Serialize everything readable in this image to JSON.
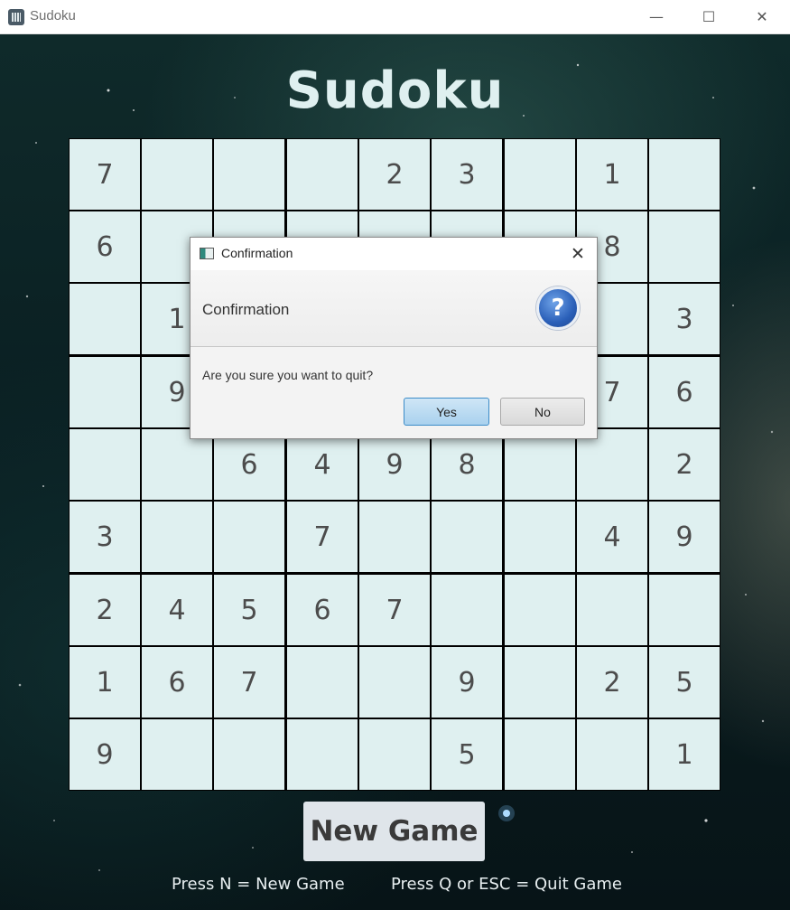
{
  "window": {
    "title": "Sudoku",
    "minimize_glyph": "—",
    "maximize_glyph": "☐",
    "close_glyph": "✕"
  },
  "game": {
    "title": "Sudoku",
    "new_game_label": "New Game",
    "hint_new": "Press N = New Game",
    "hint_quit": "Press Q or ESC = Quit Game",
    "cell_color": "#dff0f0",
    "digit_color": "#4c4c4c"
  },
  "board": {
    "rows": [
      [
        "7",
        "",
        "",
        "",
        "2",
        "3",
        "",
        "1",
        ""
      ],
      [
        "6",
        "",
        "",
        "",
        "",
        "",
        "",
        "8",
        ""
      ],
      [
        "",
        "1",
        "",
        "",
        "",
        "",
        "",
        "",
        "3"
      ],
      [
        "",
        "9",
        "",
        "",
        "",
        "",
        "",
        "7",
        "6"
      ],
      [
        "",
        "",
        "6",
        "4",
        "9",
        "8",
        "",
        "",
        "2"
      ],
      [
        "3",
        "",
        "",
        "7",
        "",
        "",
        "",
        "4",
        "9"
      ],
      [
        "2",
        "4",
        "5",
        "6",
        "7",
        "",
        "",
        "",
        ""
      ],
      [
        "1",
        "6",
        "7",
        "",
        "",
        "9",
        "",
        "2",
        "5"
      ],
      [
        "9",
        "",
        "",
        "",
        "",
        "5",
        "",
        "",
        "1"
      ]
    ]
  },
  "dialog": {
    "window_title": "Confirmation",
    "header_text": "Confirmation",
    "help_icon": "question-icon",
    "help_glyph": "?",
    "close_glyph": "✕",
    "message": "Are you sure you want to quit?",
    "yes_label": "Yes",
    "no_label": "No",
    "default_button_color": "#a9d1ee"
  }
}
